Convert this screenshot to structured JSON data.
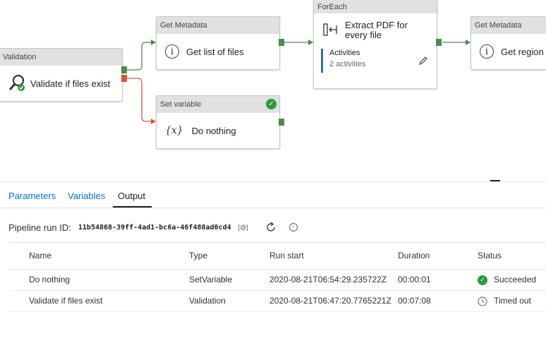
{
  "activities": {
    "validation": {
      "type": "Validation",
      "name": "Validate if files exist"
    },
    "get_metadata_1": {
      "type": "Get Metadata",
      "name": "Get list of files"
    },
    "set_variable": {
      "type": "Set variable",
      "name": "Do nothing"
    },
    "foreach": {
      "type": "ForEach",
      "name": "Extract PDF for every file",
      "activities_label": "Activities",
      "activities_count": "2 activities"
    },
    "get_metadata_2": {
      "type": "Get Metadata",
      "name": "Get region"
    }
  },
  "tabs": [
    {
      "label": "Parameters"
    },
    {
      "label": "Variables"
    },
    {
      "label": "Output"
    }
  ],
  "run": {
    "label": "Pipeline run ID:",
    "id": "11b54868-39ff-4ad1-bc6a-46f488ad0cd4",
    "copy_label": "[@]"
  },
  "table": {
    "headers": [
      "Name",
      "Type",
      "Run start",
      "Duration",
      "Status"
    ],
    "rows": [
      {
        "name": "Do nothing",
        "type": "SetVariable",
        "run_start": "2020-08-21T06:54:29.235722Z",
        "duration": "00:00:01",
        "status": "Succeeded",
        "status_icon": "check-circle-icon"
      },
      {
        "name": "Validate if files exist",
        "type": "Validation",
        "run_start": "2020-08-21T06:47:20.7765221Z",
        "duration": "00:07:08",
        "status": "Timed out",
        "status_icon": "clock-icon"
      }
    ]
  },
  "colors": {
    "success": "#2b9b3d",
    "failure_port": "#d65533",
    "success_port": "#4d8a4d",
    "link": "#0f6cbd"
  }
}
